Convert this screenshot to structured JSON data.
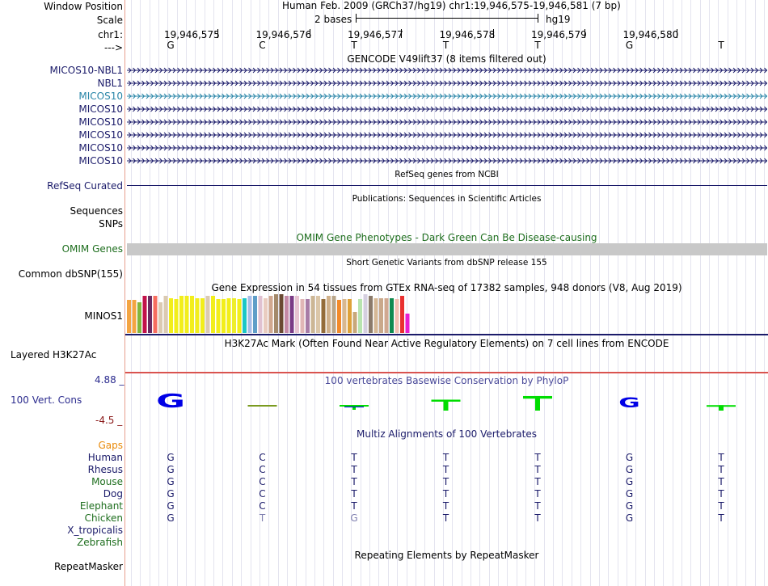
{
  "header": {
    "window_position_label": "Window Position",
    "scale_label": "Scale",
    "chrom_label": "chr1:",
    "arrow_label": "--->",
    "assembly_title": "Human Feb. 2009 (GRCh37/hg19)   chr1:19,946,575-19,946,581 (7 bp)",
    "scale_text": "2 bases",
    "scale_db": "hg19",
    "positions": [
      "19,946,575",
      "19,946,576",
      "19,946,577",
      "19,946,578",
      "19,946,579",
      "19,946,580"
    ],
    "sequence": [
      "G",
      "C",
      "T",
      "T",
      "T",
      "G",
      "T"
    ]
  },
  "gencode": {
    "title": "GENCODE V49lift37 (8 items filtered out)",
    "genes": [
      {
        "name": "MICOS10-NBL1",
        "color": "#1b1b6a"
      },
      {
        "name": "NBL1",
        "color": "#1b1b6a"
      },
      {
        "name": "MICOS10",
        "color": "#2a86a8"
      },
      {
        "name": "MICOS10",
        "color": "#1b1b6a"
      },
      {
        "name": "MICOS10",
        "color": "#1b1b6a"
      },
      {
        "name": "MICOS10",
        "color": "#1b1b6a"
      },
      {
        "name": "MICOS10",
        "color": "#1b1b6a"
      },
      {
        "name": "MICOS10",
        "color": "#1b1b6a"
      }
    ]
  },
  "refseq": {
    "title": "RefSeq genes from NCBI",
    "label": "RefSeq Curated"
  },
  "publications": {
    "title": "Publications: Sequences in Scientific Articles",
    "label1": "Sequences",
    "label2": "SNPs"
  },
  "omim": {
    "title": "OMIM Gene Phenotypes - Dark Green Can Be Disease-causing",
    "label": "OMIM Genes"
  },
  "dbsnp": {
    "title": "Short Genetic Variants from dbSNP release 155",
    "label": "Common dbSNP(155)"
  },
  "gtex": {
    "title": "Gene Expression in 54 tissues from GTEx RNA-seq of 17382 samples, 948 donors (V8, Aug 2019)",
    "label": "MINOS1",
    "values": [
      0.85,
      0.85,
      0.8,
      0.95,
      0.95,
      0.95,
      0.8,
      0.95,
      0.9,
      0.88,
      0.95,
      0.95,
      0.95,
      0.9,
      0.9,
      0.95,
      0.95,
      0.88,
      0.88,
      0.9,
      0.9,
      0.88,
      0.9,
      0.95,
      0.95,
      0.95,
      0.9,
      0.95,
      1.0,
      1.0,
      0.95,
      0.95,
      0.95,
      0.88,
      0.88,
      0.95,
      0.95,
      0.88,
      0.95,
      0.95,
      0.85,
      0.88,
      0.88,
      0.55,
      0.88,
      1.0,
      0.95,
      0.9,
      0.9,
      0.9,
      0.9,
      0.88,
      0.95,
      0.5
    ],
    "colors": [
      "#f4a442",
      "#f4a442",
      "#83b53d",
      "#c2124a",
      "#6d2a61",
      "#f76d5e",
      "#dbcab1",
      "#dbcab1",
      "#f2ee1a",
      "#f2ee1a",
      "#f2ee1a",
      "#f2ee1a",
      "#f2ee1a",
      "#f2ee1a",
      "#f2ee1a",
      "#dbcab1",
      "#f2ee1a",
      "#f2ee1a",
      "#f2ee1a",
      "#f2ee1a",
      "#eeee2a",
      "#f2ee1a",
      "#1bc7c7",
      "#a7bde8",
      "#5f9ec8",
      "#e0c1d1",
      "#e9ccc0",
      "#d1a890",
      "#a3896b",
      "#6a4a32",
      "#c48aa6",
      "#7a3b86",
      "#e7c4d1",
      "#e0b6b6",
      "#a77ba6",
      "#ccb694",
      "#dbc6a8",
      "#946c3a",
      "#d0b08a",
      "#b9a68a",
      "#f38a2a",
      "#d8b890",
      "#dea23a",
      "#c8a87a",
      "#b8e4b0",
      "#d5cfe0",
      "#8b7a6a",
      "#d6b896",
      "#c9a88a",
      "#d0a890",
      "#0f8a4f",
      "#f0c0b0",
      "#e93030",
      "#e81ecf"
    ]
  },
  "h3k27ac": {
    "title": "H3K27Ac Mark (Often Found Near Active Regulatory Elements) on 7 cell lines from ENCODE",
    "label": "Layered H3K27Ac"
  },
  "phylop": {
    "title": "100 vertebrates Basewise Conservation by PhyloP",
    "label": "100 Vert. Cons",
    "max_label": "4.88 _",
    "min_label": "-4.5 _",
    "max": 4.88,
    "min": -4.5,
    "scores": [
      4.0,
      -0.3,
      -1.0,
      3.0,
      4.0,
      3.0,
      1.5
    ],
    "bases": [
      "G",
      "C",
      "T",
      "T",
      "T",
      "G",
      "T"
    ]
  },
  "multiz": {
    "title": "Multiz Alignments of 100 Vertebrates",
    "gaps_label": "Gaps",
    "species": [
      {
        "name": "Human",
        "color": "#1b1b6a",
        "bases": [
          "G",
          "C",
          "T",
          "T",
          "T",
          "G",
          "T"
        ],
        "dim": [
          false,
          false,
          false,
          false,
          false,
          false,
          false
        ]
      },
      {
        "name": "Rhesus",
        "color": "#1b1b6a",
        "bases": [
          "G",
          "C",
          "T",
          "T",
          "T",
          "G",
          "T"
        ],
        "dim": [
          false,
          false,
          false,
          false,
          false,
          false,
          false
        ]
      },
      {
        "name": "Mouse",
        "color": "#1e6e1e",
        "bases": [
          "G",
          "C",
          "T",
          "T",
          "T",
          "G",
          "T"
        ],
        "dim": [
          false,
          false,
          false,
          false,
          false,
          false,
          false
        ]
      },
      {
        "name": "Dog",
        "color": "#1b1b6a",
        "bases": [
          "G",
          "C",
          "T",
          "T",
          "T",
          "G",
          "T"
        ],
        "dim": [
          false,
          false,
          false,
          false,
          false,
          false,
          false
        ]
      },
      {
        "name": "Elephant",
        "color": "#1e6e1e",
        "bases": [
          "G",
          "C",
          "T",
          "T",
          "T",
          "G",
          "T"
        ],
        "dim": [
          false,
          false,
          false,
          false,
          false,
          false,
          false
        ]
      },
      {
        "name": "Chicken",
        "color": "#1e6e1e",
        "bases": [
          "G",
          "T",
          "G",
          "T",
          "T",
          "G",
          "T"
        ],
        "dim": [
          false,
          true,
          true,
          false,
          false,
          false,
          false
        ]
      },
      {
        "name": "X_tropicalis",
        "color": "#1b1b6a",
        "bases": [],
        "dim": []
      },
      {
        "name": "Zebrafish",
        "color": "#1e6e1e",
        "bases": [],
        "dim": []
      }
    ]
  },
  "repeatmasker": {
    "title": "Repeating Elements by RepeatMasker",
    "label": "RepeatMasker"
  }
}
